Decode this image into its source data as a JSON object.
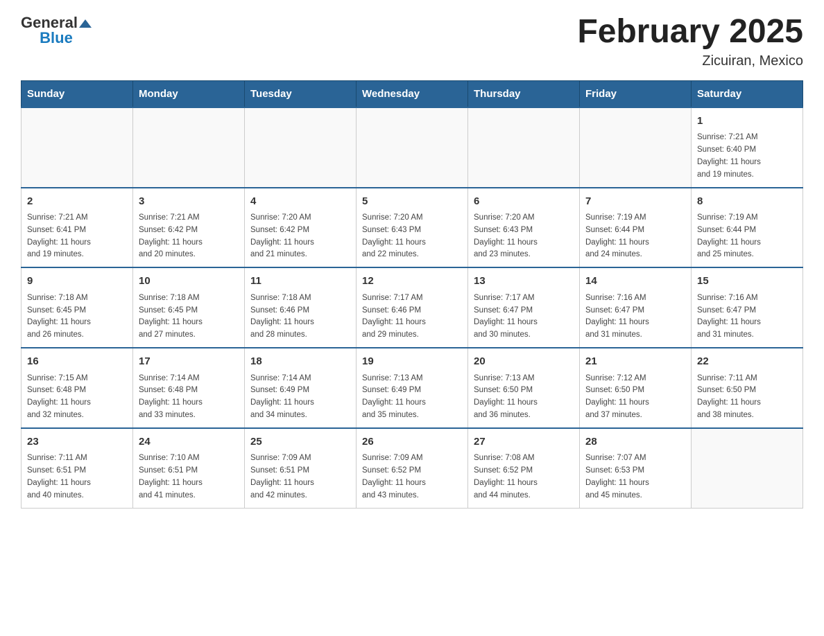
{
  "logo": {
    "text_general": "General",
    "text_blue": "Blue"
  },
  "header": {
    "month_title": "February 2025",
    "location": "Zicuiran, Mexico"
  },
  "days_of_week": [
    "Sunday",
    "Monday",
    "Tuesday",
    "Wednesday",
    "Thursday",
    "Friday",
    "Saturday"
  ],
  "weeks": [
    [
      {
        "day": "",
        "info": ""
      },
      {
        "day": "",
        "info": ""
      },
      {
        "day": "",
        "info": ""
      },
      {
        "day": "",
        "info": ""
      },
      {
        "day": "",
        "info": ""
      },
      {
        "day": "",
        "info": ""
      },
      {
        "day": "1",
        "info": "Sunrise: 7:21 AM\nSunset: 6:40 PM\nDaylight: 11 hours\nand 19 minutes."
      }
    ],
    [
      {
        "day": "2",
        "info": "Sunrise: 7:21 AM\nSunset: 6:41 PM\nDaylight: 11 hours\nand 19 minutes."
      },
      {
        "day": "3",
        "info": "Sunrise: 7:21 AM\nSunset: 6:42 PM\nDaylight: 11 hours\nand 20 minutes."
      },
      {
        "day": "4",
        "info": "Sunrise: 7:20 AM\nSunset: 6:42 PM\nDaylight: 11 hours\nand 21 minutes."
      },
      {
        "day": "5",
        "info": "Sunrise: 7:20 AM\nSunset: 6:43 PM\nDaylight: 11 hours\nand 22 minutes."
      },
      {
        "day": "6",
        "info": "Sunrise: 7:20 AM\nSunset: 6:43 PM\nDaylight: 11 hours\nand 23 minutes."
      },
      {
        "day": "7",
        "info": "Sunrise: 7:19 AM\nSunset: 6:44 PM\nDaylight: 11 hours\nand 24 minutes."
      },
      {
        "day": "8",
        "info": "Sunrise: 7:19 AM\nSunset: 6:44 PM\nDaylight: 11 hours\nand 25 minutes."
      }
    ],
    [
      {
        "day": "9",
        "info": "Sunrise: 7:18 AM\nSunset: 6:45 PM\nDaylight: 11 hours\nand 26 minutes."
      },
      {
        "day": "10",
        "info": "Sunrise: 7:18 AM\nSunset: 6:45 PM\nDaylight: 11 hours\nand 27 minutes."
      },
      {
        "day": "11",
        "info": "Sunrise: 7:18 AM\nSunset: 6:46 PM\nDaylight: 11 hours\nand 28 minutes."
      },
      {
        "day": "12",
        "info": "Sunrise: 7:17 AM\nSunset: 6:46 PM\nDaylight: 11 hours\nand 29 minutes."
      },
      {
        "day": "13",
        "info": "Sunrise: 7:17 AM\nSunset: 6:47 PM\nDaylight: 11 hours\nand 30 minutes."
      },
      {
        "day": "14",
        "info": "Sunrise: 7:16 AM\nSunset: 6:47 PM\nDaylight: 11 hours\nand 31 minutes."
      },
      {
        "day": "15",
        "info": "Sunrise: 7:16 AM\nSunset: 6:47 PM\nDaylight: 11 hours\nand 31 minutes."
      }
    ],
    [
      {
        "day": "16",
        "info": "Sunrise: 7:15 AM\nSunset: 6:48 PM\nDaylight: 11 hours\nand 32 minutes."
      },
      {
        "day": "17",
        "info": "Sunrise: 7:14 AM\nSunset: 6:48 PM\nDaylight: 11 hours\nand 33 minutes."
      },
      {
        "day": "18",
        "info": "Sunrise: 7:14 AM\nSunset: 6:49 PM\nDaylight: 11 hours\nand 34 minutes."
      },
      {
        "day": "19",
        "info": "Sunrise: 7:13 AM\nSunset: 6:49 PM\nDaylight: 11 hours\nand 35 minutes."
      },
      {
        "day": "20",
        "info": "Sunrise: 7:13 AM\nSunset: 6:50 PM\nDaylight: 11 hours\nand 36 minutes."
      },
      {
        "day": "21",
        "info": "Sunrise: 7:12 AM\nSunset: 6:50 PM\nDaylight: 11 hours\nand 37 minutes."
      },
      {
        "day": "22",
        "info": "Sunrise: 7:11 AM\nSunset: 6:50 PM\nDaylight: 11 hours\nand 38 minutes."
      }
    ],
    [
      {
        "day": "23",
        "info": "Sunrise: 7:11 AM\nSunset: 6:51 PM\nDaylight: 11 hours\nand 40 minutes."
      },
      {
        "day": "24",
        "info": "Sunrise: 7:10 AM\nSunset: 6:51 PM\nDaylight: 11 hours\nand 41 minutes."
      },
      {
        "day": "25",
        "info": "Sunrise: 7:09 AM\nSunset: 6:51 PM\nDaylight: 11 hours\nand 42 minutes."
      },
      {
        "day": "26",
        "info": "Sunrise: 7:09 AM\nSunset: 6:52 PM\nDaylight: 11 hours\nand 43 minutes."
      },
      {
        "day": "27",
        "info": "Sunrise: 7:08 AM\nSunset: 6:52 PM\nDaylight: 11 hours\nand 44 minutes."
      },
      {
        "day": "28",
        "info": "Sunrise: 7:07 AM\nSunset: 6:53 PM\nDaylight: 11 hours\nand 45 minutes."
      },
      {
        "day": "",
        "info": ""
      }
    ]
  ]
}
